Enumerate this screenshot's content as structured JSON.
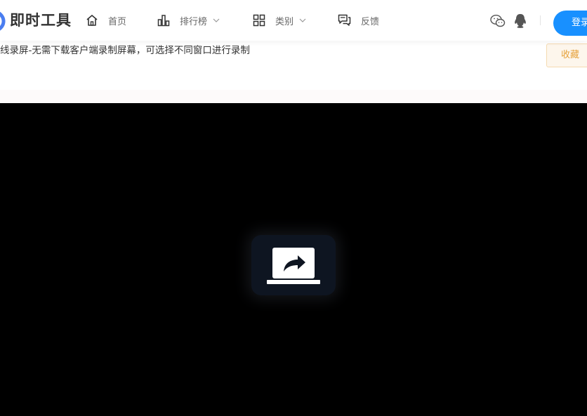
{
  "header": {
    "logo_text": "即时工具",
    "nav": [
      {
        "label": "首页",
        "icon": "home-icon",
        "dropdown": false
      },
      {
        "label": "排行榜",
        "icon": "bar-chart-icon",
        "dropdown": true
      },
      {
        "label": "类别",
        "icon": "grid-icon",
        "dropdown": true
      },
      {
        "label": "反馈",
        "icon": "feedback-icon",
        "dropdown": false
      }
    ],
    "login_label": "登录"
  },
  "tool": {
    "description": "线录屏-无需下载客户端录制屏幕，可选择不同窗口进行录制",
    "favorite_label": "收藏"
  },
  "player": {
    "center_icon": "share-screen-icon"
  },
  "colors": {
    "primary": "#1890ff",
    "favorite_bg": "#fdf6ec",
    "favorite_text": "#e6a23c",
    "player_bg": "#000000"
  }
}
